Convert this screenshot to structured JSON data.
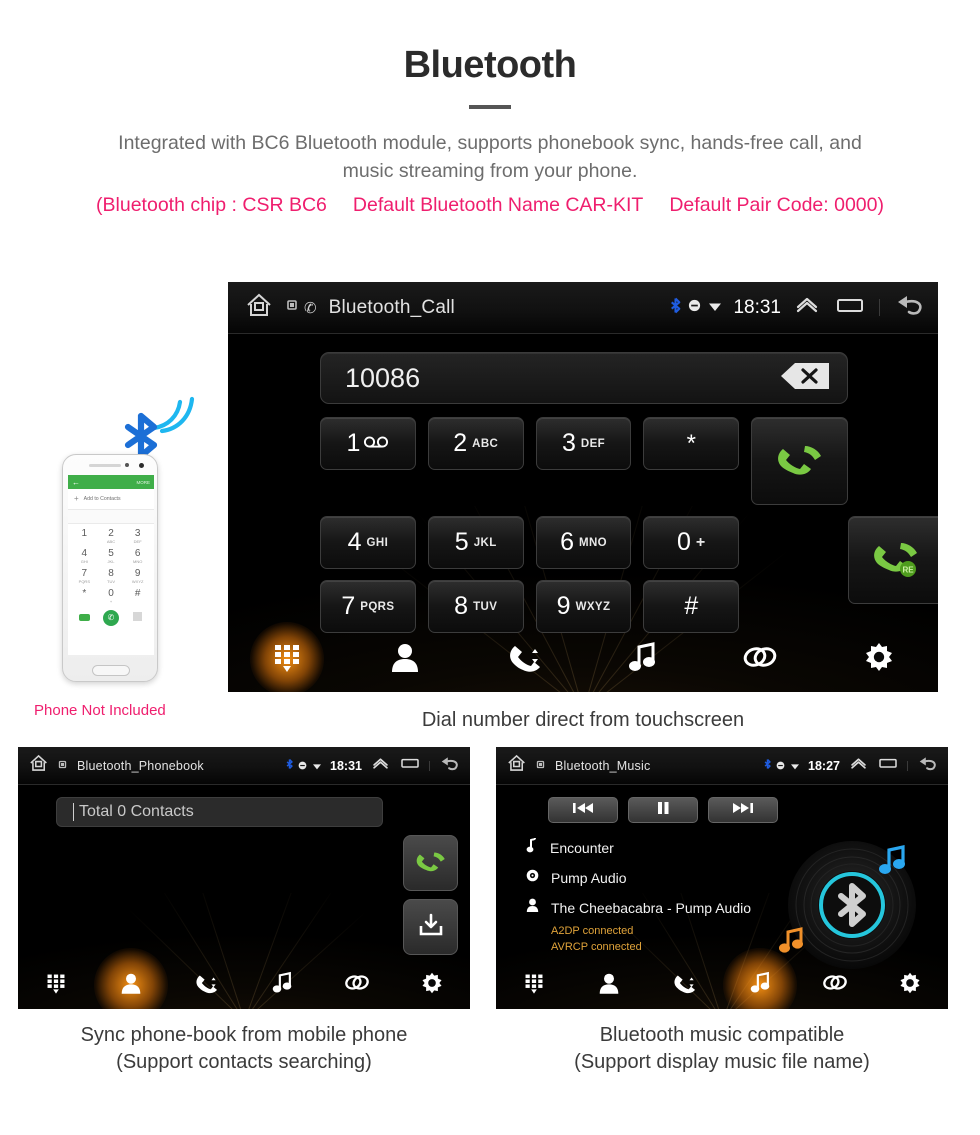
{
  "header": {
    "title": "Bluetooth",
    "intro_line1": "Integrated with BC6 Bluetooth module, supports phonebook sync, hands-free call, and",
    "intro_line2": "music streaming from your phone.",
    "spec_chip": "(Bluetooth chip : CSR BC6",
    "spec_name": "Default Bluetooth Name CAR-KIT",
    "spec_pair": "Default Pair Code: 0000)"
  },
  "colors": {
    "accent_pink": "#ef1e6e",
    "nav_active": "#ffa01e",
    "green": "#7ac943",
    "bluetooth_blue": "#2a6fd6",
    "status_orange": "#e0a33a",
    "cyan": "#25c6dc"
  },
  "phone_illustration": {
    "caption": "Phone Not Included",
    "appbar_more": "MORE",
    "add_contact": "Add to Contacts",
    "keys": [
      [
        {
          "n": "1",
          "s": ""
        },
        {
          "n": "2",
          "s": "ABC"
        },
        {
          "n": "3",
          "s": "DEF"
        }
      ],
      [
        {
          "n": "4",
          "s": "GHI"
        },
        {
          "n": "5",
          "s": "JKL"
        },
        {
          "n": "6",
          "s": "MNO"
        }
      ],
      [
        {
          "n": "7",
          "s": "PQRS"
        },
        {
          "n": "8",
          "s": "TUV"
        },
        {
          "n": "9",
          "s": "WXYZ"
        }
      ],
      [
        {
          "n": "*",
          "s": ""
        },
        {
          "n": "0",
          "s": "+"
        },
        {
          "n": "#",
          "s": ""
        }
      ]
    ]
  },
  "call_screen": {
    "status": {
      "title": "Bluetooth_Call",
      "time": "18:31",
      "icons": [
        "home-icon",
        "sim-icon",
        "phone-icon",
        "bluetooth-icon",
        "dnd-icon",
        "wifi-icon",
        "chevron-up-icon",
        "recents-icon",
        "back-icon"
      ]
    },
    "dialed_number": "10086",
    "backspace_label": "×",
    "keys": [
      [
        {
          "num": "1",
          "sub": "",
          "glyph": "voicemail"
        },
        {
          "num": "2",
          "sub": "ABC"
        },
        {
          "num": "3",
          "sub": "DEF"
        },
        {
          "num": "*",
          "sub": ""
        }
      ],
      [
        {
          "num": "4",
          "sub": "GHI"
        },
        {
          "num": "5",
          "sub": "JKL"
        },
        {
          "num": "6",
          "sub": "MNO"
        },
        {
          "num": "0",
          "sub": "+"
        }
      ],
      [
        {
          "num": "7",
          "sub": "PQRS"
        },
        {
          "num": "8",
          "sub": "TUV"
        },
        {
          "num": "9",
          "sub": "WXYZ"
        },
        {
          "num": "#",
          "sub": ""
        }
      ]
    ],
    "call_button": "call",
    "redial_button_label": "RE",
    "nav": [
      {
        "name": "keypad",
        "active": true
      },
      {
        "name": "contacts",
        "active": false
      },
      {
        "name": "call-history",
        "active": false
      },
      {
        "name": "music",
        "active": false
      },
      {
        "name": "pairing",
        "active": false
      },
      {
        "name": "settings",
        "active": false
      }
    ],
    "caption": "Dial number direct from touchscreen"
  },
  "phonebook_screen": {
    "status": {
      "title": "Bluetooth_Phonebook",
      "time": "18:31"
    },
    "search_value": "Total 0 Contacts",
    "nav": [
      {
        "name": "keypad",
        "active": false
      },
      {
        "name": "contacts",
        "active": true
      },
      {
        "name": "call-history",
        "active": false
      },
      {
        "name": "music",
        "active": false
      },
      {
        "name": "pairing",
        "active": false
      },
      {
        "name": "settings",
        "active": false
      }
    ],
    "caption_line1": "Sync phone-book from mobile phone",
    "caption_line2": "(Support contacts searching)"
  },
  "music_screen": {
    "status": {
      "title": "Bluetooth_Music",
      "time": "18:27"
    },
    "transport": [
      {
        "name": "previous",
        "glyph": "⏮"
      },
      {
        "name": "pause",
        "glyph": "❙❙"
      },
      {
        "name": "next",
        "glyph": "⏭"
      }
    ],
    "track_title": "Encounter",
    "album": "Pump Audio",
    "artist": "The Cheebacabra - Pump Audio",
    "status_a2dp": "A2DP connected",
    "status_avrcp": "AVRCP connected",
    "nav": [
      {
        "name": "keypad",
        "active": false
      },
      {
        "name": "contacts",
        "active": false
      },
      {
        "name": "call-history",
        "active": false
      },
      {
        "name": "music",
        "active": true
      },
      {
        "name": "pairing",
        "active": false
      },
      {
        "name": "settings",
        "active": false
      }
    ],
    "caption_line1": "Bluetooth music compatible",
    "caption_line2": "(Support display music file name)"
  }
}
